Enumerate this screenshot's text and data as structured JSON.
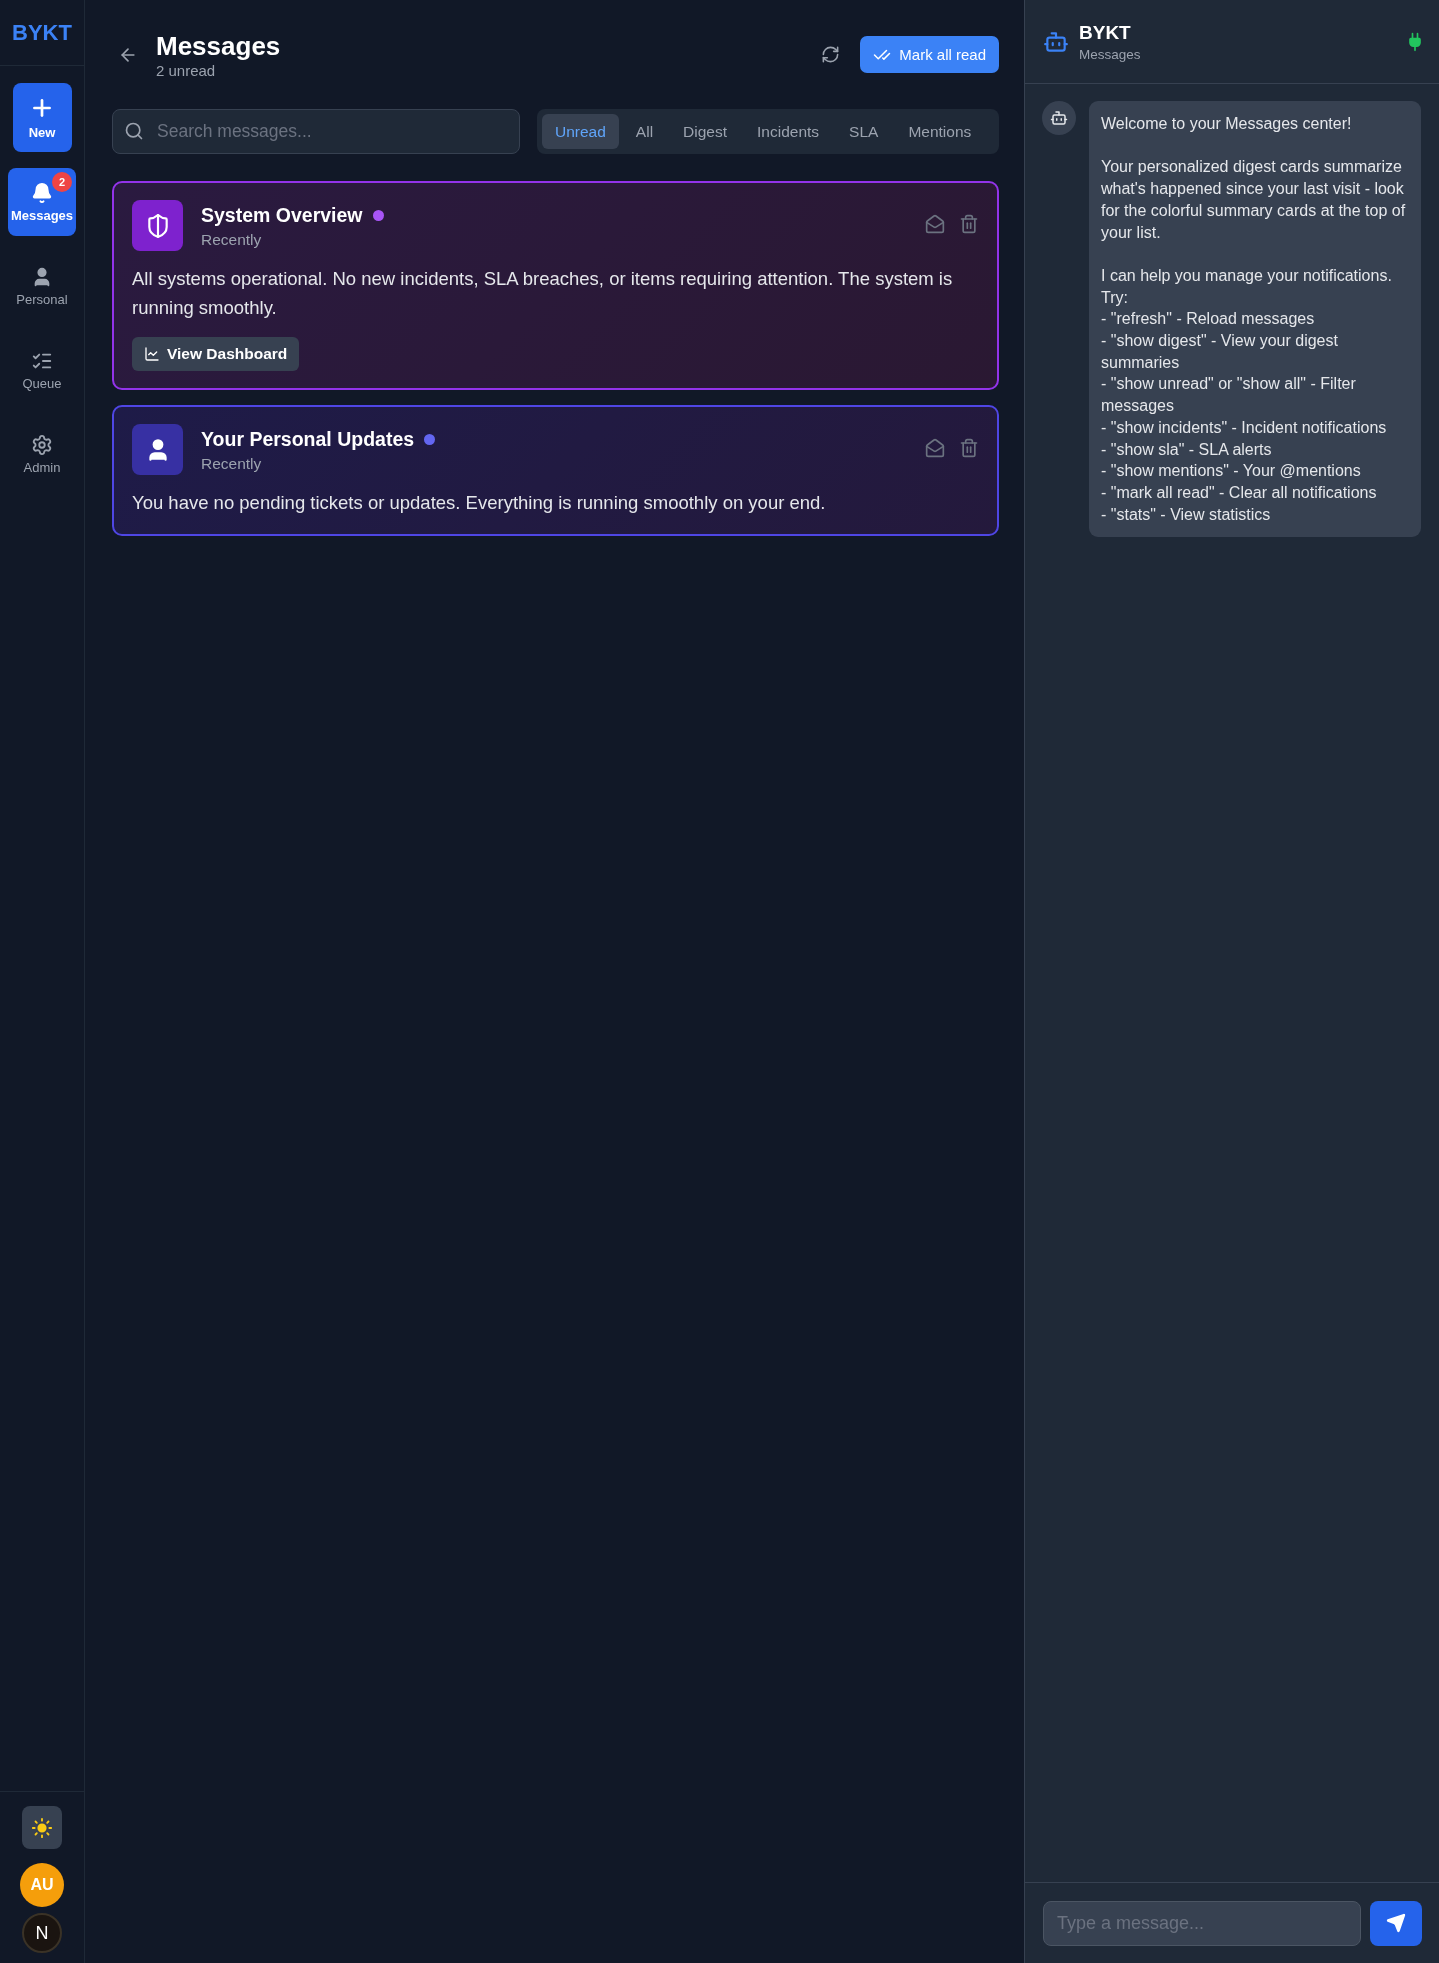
{
  "sidebar": {
    "logo": "BYKT",
    "items": [
      {
        "kind": "create",
        "label": "New"
      },
      {
        "kind": "inbox",
        "label": "Messages",
        "selected": true,
        "badge": "2"
      },
      {
        "kind": "person",
        "label": "Personal",
        "selected": false
      },
      {
        "kind": "queue",
        "label": "Queue",
        "selected": false
      },
      {
        "kind": "admin",
        "label": "Admin",
        "selected": false
      }
    ],
    "user": {
      "initials": "AU"
    },
    "dev_badge": "N"
  },
  "header": {
    "title": "Messages",
    "subtitle": "2 unread",
    "mark_all_button": "Mark all read"
  },
  "search": {
    "placeholder": "Search messages..."
  },
  "tabs": [
    {
      "label": "Unread",
      "selected": true
    },
    {
      "label": "All",
      "selected": false
    },
    {
      "label": "Digest",
      "selected": false
    },
    {
      "label": "Incidents",
      "selected": false
    },
    {
      "label": "SLA",
      "selected": false
    },
    {
      "label": "Mentions",
      "selected": false
    }
  ],
  "cards": [
    {
      "kind": "system",
      "title": "System Overview",
      "time": "Recently",
      "color": "#a855f7",
      "body": "All systems operational. No new incidents, SLA breaches, or items requiring attention. The system is running smoothly.",
      "action": "View Dashboard"
    },
    {
      "kind": "personal",
      "title": "Your Personal Updates",
      "time": "Recently",
      "color": "#6366f1",
      "body": "You have no pending tickets or updates. Everything is running smoothly on your end."
    }
  ],
  "assistant": {
    "title": "BYKT",
    "subtitle": "Messages",
    "messages": [
      "Welcome to your Messages center!\n\nYour personalized digest cards summarize what's happened since your last visit - look for the colorful summary cards at the top of your list.\n\nI can help you manage your notifications. Try:\n- \"refresh\" - Reload messages\n- \"show digest\" - View your digest summaries\n- \"show unread\" or \"show all\" - Filter messages\n- \"show incidents\" - Incident notifications\n- \"show sla\" - SLA alerts\n- \"show mentions\" - Your @mentions\n- \"mark all read\" - Clear all notifications\n- \"stats\" - View statistics"
    ],
    "input_placeholder": "Type a message..."
  }
}
